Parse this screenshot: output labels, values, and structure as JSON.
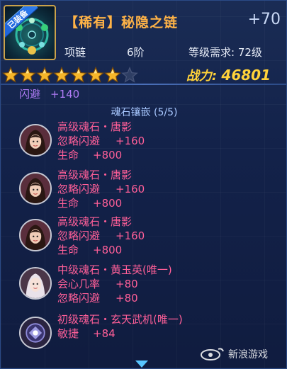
{
  "item": {
    "rarity_name": "【稀有】秘隐之链",
    "enhance": "+70",
    "equipped_badge": "已装备",
    "type": "项链",
    "tier": "6阶",
    "level_req": "等级需求: 72级",
    "stars_filled": 7,
    "stars_total": 8,
    "power_label": "战力:",
    "power_value": "46801"
  },
  "stat_partial": {
    "label": "闪避",
    "value": "+140"
  },
  "gem_section": {
    "title": "魂石镶嵌 (5/5)"
  },
  "gems": [
    {
      "portrait": "female-portrait-icon",
      "name": "高级魂石・唐影",
      "stats": [
        {
          "label": "忽略闪避",
          "value": "+160"
        },
        {
          "label": "生命",
          "value": "+800"
        }
      ]
    },
    {
      "portrait": "female-portrait-icon",
      "name": "高级魂石・唐影",
      "stats": [
        {
          "label": "忽略闪避",
          "value": "+160"
        },
        {
          "label": "生命",
          "value": "+800"
        }
      ]
    },
    {
      "portrait": "female-portrait-icon",
      "name": "高级魂石・唐影",
      "stats": [
        {
          "label": "忽略闪避",
          "value": "+160"
        },
        {
          "label": "生命",
          "value": "+800"
        }
      ]
    },
    {
      "portrait": "pale-female-portrait-icon",
      "name": "中级魂石・黄玉英(唯一)",
      "stats": [
        {
          "label": "会心几率",
          "value": "+80"
        },
        {
          "label": "忽略闪避",
          "value": "+80"
        }
      ]
    },
    {
      "portrait": "mech-portrait-icon",
      "name": "初级魂石・玄天武机(唯一)",
      "stats": [
        {
          "label": "敏捷",
          "value": "+84"
        }
      ]
    }
  ],
  "watermark": {
    "text": "新浪游戏",
    "logo": "sina-eye-logo"
  },
  "colors": {
    "title_orange": "#ffb347",
    "gem_pink": "#ff5f98",
    "stat_purple": "#b37cf6",
    "power_yellow": "#ffd23a",
    "star_gold": "#f6b72a"
  }
}
